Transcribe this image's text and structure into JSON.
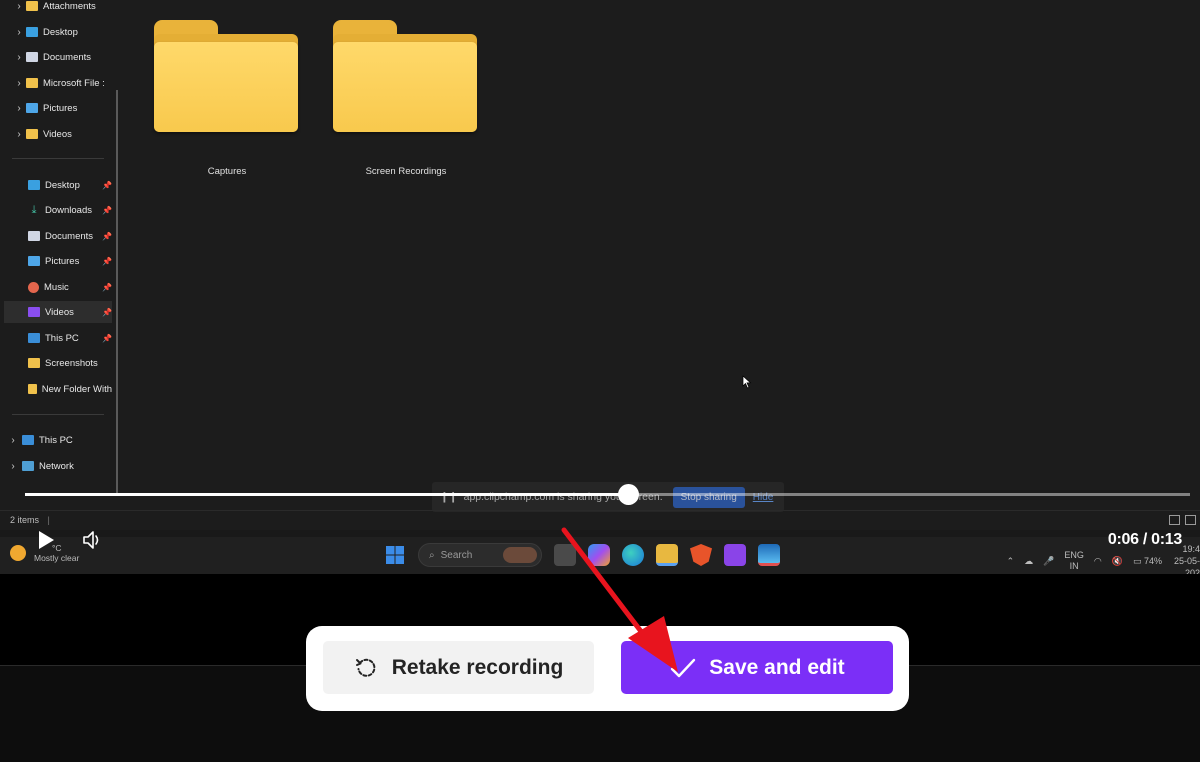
{
  "explorer": {
    "nav_tree": [
      {
        "label": "Attachments",
        "icon": "folder-icon"
      },
      {
        "label": "Desktop",
        "icon": "desktop-icon"
      },
      {
        "label": "Documents",
        "icon": "documents-icon"
      },
      {
        "label": "Microsoft File :",
        "icon": "folder-icon"
      },
      {
        "label": "Pictures",
        "icon": "pictures-icon"
      },
      {
        "label": "Videos",
        "icon": "folder-icon"
      }
    ],
    "quick_access": [
      {
        "label": "Desktop",
        "icon": "desktop-icon",
        "pinned": true
      },
      {
        "label": "Downloads",
        "icon": "download-icon",
        "pinned": true
      },
      {
        "label": "Documents",
        "icon": "documents-icon",
        "pinned": true
      },
      {
        "label": "Pictures",
        "icon": "pictures-icon",
        "pinned": true
      },
      {
        "label": "Music",
        "icon": "music-icon",
        "pinned": true
      },
      {
        "label": "Videos",
        "icon": "videos-icon",
        "pinned": true,
        "selected": true
      },
      {
        "label": "This PC",
        "icon": "this-pc-icon",
        "pinned": true
      },
      {
        "label": "Screenshots",
        "icon": "folder-icon",
        "pinned": false
      },
      {
        "label": "New Folder With",
        "icon": "folder-icon",
        "pinned": false
      }
    ],
    "roots": [
      {
        "label": "This PC",
        "icon": "this-pc-icon"
      },
      {
        "label": "Network",
        "icon": "network-icon"
      }
    ],
    "folders": [
      {
        "label": "Captures"
      },
      {
        "label": "Screen Recordings"
      }
    ],
    "status": "2 items"
  },
  "share_banner": {
    "message": "app.clipchamp.com is sharing your screen.",
    "stop_label": "Stop sharing",
    "hide_label": "Hide"
  },
  "player": {
    "time": "0:06 / 0:13",
    "progress": 0.518
  },
  "taskbar": {
    "weather_temp": "°C",
    "weather_desc": "Mostly clear",
    "search_placeholder": "Search",
    "lang_1": "ENG",
    "lang_2": "IN",
    "battery": "74%",
    "clock_time": "19:4",
    "clock_date": "25-05-202"
  },
  "actions": {
    "retake_label": "Retake recording",
    "save_label": "Save and edit"
  },
  "colors": {
    "save_button": "#7b2ff7",
    "folder_yellow": "#f8c94d",
    "annotation_arrow": "#e8141e"
  }
}
